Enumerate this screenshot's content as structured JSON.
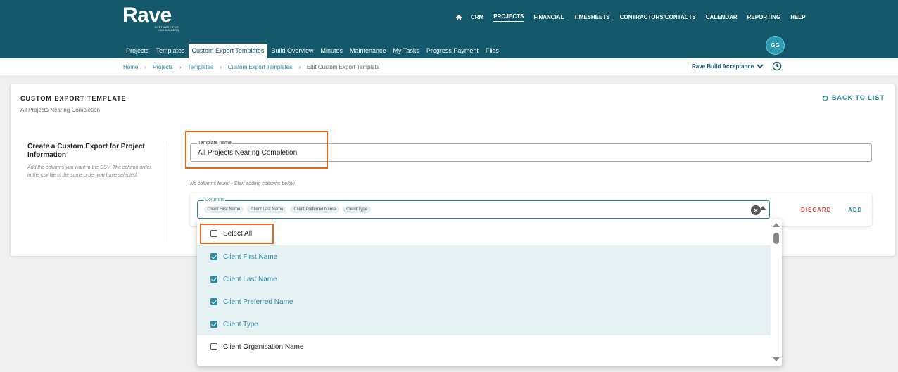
{
  "brand": {
    "name": "Rave",
    "tagline_1": "SOFTWARE FOR",
    "tagline_2": "KIWI BUILDERS"
  },
  "main_nav": [
    "CRM",
    "PROJECTS",
    "FINANCIAL",
    "TIMESHEETS",
    "CONTRACTORS/CONTACTS",
    "CALENDAR",
    "REPORTING",
    "HELP"
  ],
  "sub_nav": [
    "Projects",
    "Templates",
    "Custom Export Templates",
    "Build Overview",
    "Minutes",
    "Maintenance",
    "My Tasks",
    "Progress Payment",
    "Files"
  ],
  "user": {
    "initials": "GG"
  },
  "breadcrumb": [
    "Home",
    "Projects",
    "Templates",
    "Custom Export Templates",
    "Edit Custom Export Template"
  ],
  "project_selector": "Rave Build Acceptance",
  "card": {
    "title": "CUSTOM EXPORT TEMPLATE",
    "subtitle": "All Projects Nearing Completion",
    "back_label": "BACK TO LIST",
    "section_title": "Create a Custom Export for Project Information",
    "section_desc": "Add the columns you want in the CSV. The column order in the csv file is the same order you have selected."
  },
  "template_name": {
    "label": "Template name",
    "value": "All Projects Nearing Completion"
  },
  "no_columns_msg": "No columns found - Start adding columns below",
  "columns": {
    "label": "Columns",
    "chips": [
      "Client First Name",
      "Client Last Name",
      "Client Preferred Name",
      "Client Type"
    ],
    "discard_label": "DISCARD",
    "add_label": "ADD"
  },
  "dropdown": {
    "select_all": "Select All",
    "options": [
      {
        "label": "Client First Name",
        "checked": true
      },
      {
        "label": "Client Last Name",
        "checked": true
      },
      {
        "label": "Client Preferred Name",
        "checked": true
      },
      {
        "label": "Client Type",
        "checked": true
      },
      {
        "label": "Client Organisation Name",
        "checked": false
      }
    ]
  },
  "colors": {
    "header": "#13596b",
    "accent": "#2a8aa0",
    "danger": "#d9443f",
    "highlight": "#e8691e"
  }
}
